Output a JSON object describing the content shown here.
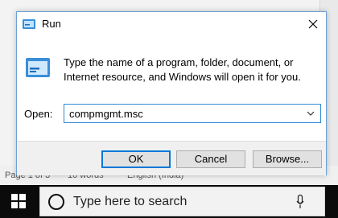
{
  "background_doc": {
    "status_page": "Page 1 of 3",
    "status_words": "10 words",
    "status_language": "English (India)"
  },
  "dialog": {
    "title": "Run",
    "icon": "run-icon",
    "description": "Type the name of a program, folder, document, or Internet resource, and Windows will open it for you.",
    "open_label": "Open:",
    "open_value": "compmgmt.msc",
    "buttons": {
      "ok": "OK",
      "cancel": "Cancel",
      "browse": "Browse..."
    }
  },
  "taskbar": {
    "start_icon": "windows-logo-icon",
    "search_placeholder": "Type here to search",
    "mic_icon": "microphone-icon"
  },
  "colors": {
    "accent": "#0078d7",
    "taskbar": "#0b0b0b",
    "dialog_border": "#6ea0d8"
  }
}
